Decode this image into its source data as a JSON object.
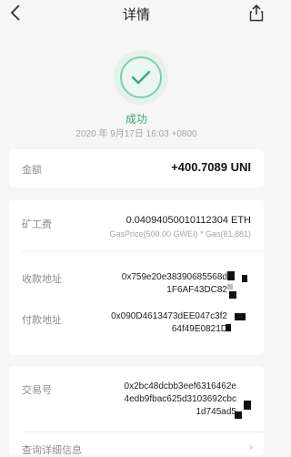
{
  "header": {
    "title": "详情"
  },
  "status": {
    "text": "成功",
    "time": "2020 年 9月17日 16:03 +0800"
  },
  "amount": {
    "label": "金额",
    "value": "+400.7089 UNI"
  },
  "fee": {
    "label": "矿工费",
    "value": "0.04094050010112304 ETH",
    "sub": "GasPrice(500.00 GWEI) * Gas(81,881)"
  },
  "to": {
    "label": "收款地址",
    "lines": [
      "0x759e20e38390685568d",
      "1F6AF43DC82"
    ]
  },
  "from": {
    "label": "付款地址",
    "lines": [
      "0x090D4613473dEE047c3f2",
      "64f49E0821D"
    ]
  },
  "tx": {
    "label": "交易号",
    "lines": [
      "0x2bc48dcbb3eef6316462e",
      "4edb9fbac625d3103692cbc",
      "1d745ad5"
    ]
  },
  "query": {
    "label": "查询详细信息"
  },
  "colors": {
    "accent": "#3aa877",
    "background": "#f6f6f6"
  },
  "icons": {
    "back": "chevron-left-icon",
    "share": "share-icon",
    "status": "check-icon",
    "query": "chevron-right-icon"
  }
}
